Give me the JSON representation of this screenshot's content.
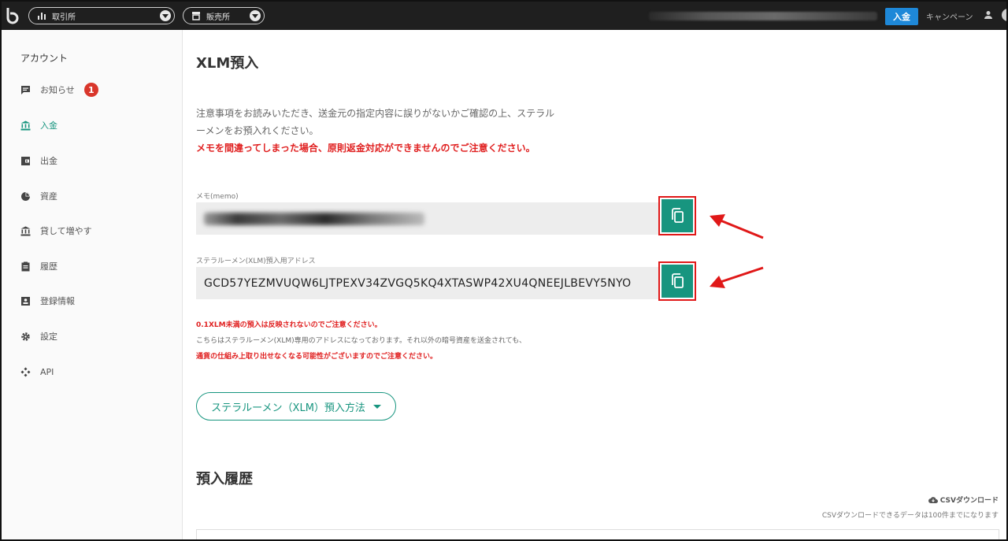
{
  "topbar": {
    "exchange_label": "取引所",
    "sales_label": "販売所",
    "deposit_button": "入金",
    "campaign_label": "キャンペーン"
  },
  "sidebar": {
    "title": "アカウント",
    "items": [
      {
        "label": "お知らせ",
        "icon": "message-icon",
        "badge": "1"
      },
      {
        "label": "入金",
        "icon": "bank-icon",
        "active": true
      },
      {
        "label": "出金",
        "icon": "wallet-icon"
      },
      {
        "label": "資産",
        "icon": "pie-chart-icon"
      },
      {
        "label": "貸して増やす",
        "icon": "bank-icon"
      },
      {
        "label": "履歴",
        "icon": "clipboard-icon"
      },
      {
        "label": "登録情報",
        "icon": "id-card-icon"
      },
      {
        "label": "設定",
        "icon": "gear-icon"
      },
      {
        "label": "API",
        "icon": "api-icon"
      }
    ]
  },
  "main": {
    "title": "XLM預入",
    "notice_line1": "注意事項をお読みいただき、送金元の指定内容に誤りがないかご確認の上、ステラル",
    "notice_line2": "ーメンをお預入れください。",
    "warning": "メモを間違ってしまった場合、原則返金対応ができませんのでご注意ください。",
    "memo_label": "メモ(memo)",
    "address_label": "ステラルーメン(XLM)預入用アドレス",
    "address_value": "GCD57YEZMVUQW6LJTPEXV34ZVGQ5KQ4XTASWP42XU4QNEEJLBEVY5NYO",
    "note_red1": "0.1XLM未満の預入は反映されないのでご注意ください。",
    "note_gray": "こちらはステラルーメン(XLM)専用のアドレスになっております。それ以外の暗号資産を送金されても、",
    "note_red2": "通貨の仕組み上取り出せなくなる可能性がございますのでご注意ください。",
    "method_button": "ステラルーメン（XLM）預入方法",
    "history_title": "預入履歴",
    "csv_download": "CSVダウンロード",
    "csv_note": "CSVダウンロードできるデータは100件までになります"
  },
  "colors": {
    "accent": "#17957f",
    "warning": "#e02020",
    "topbar": "#1f1f1f",
    "deposit_button": "#1e88d8"
  }
}
